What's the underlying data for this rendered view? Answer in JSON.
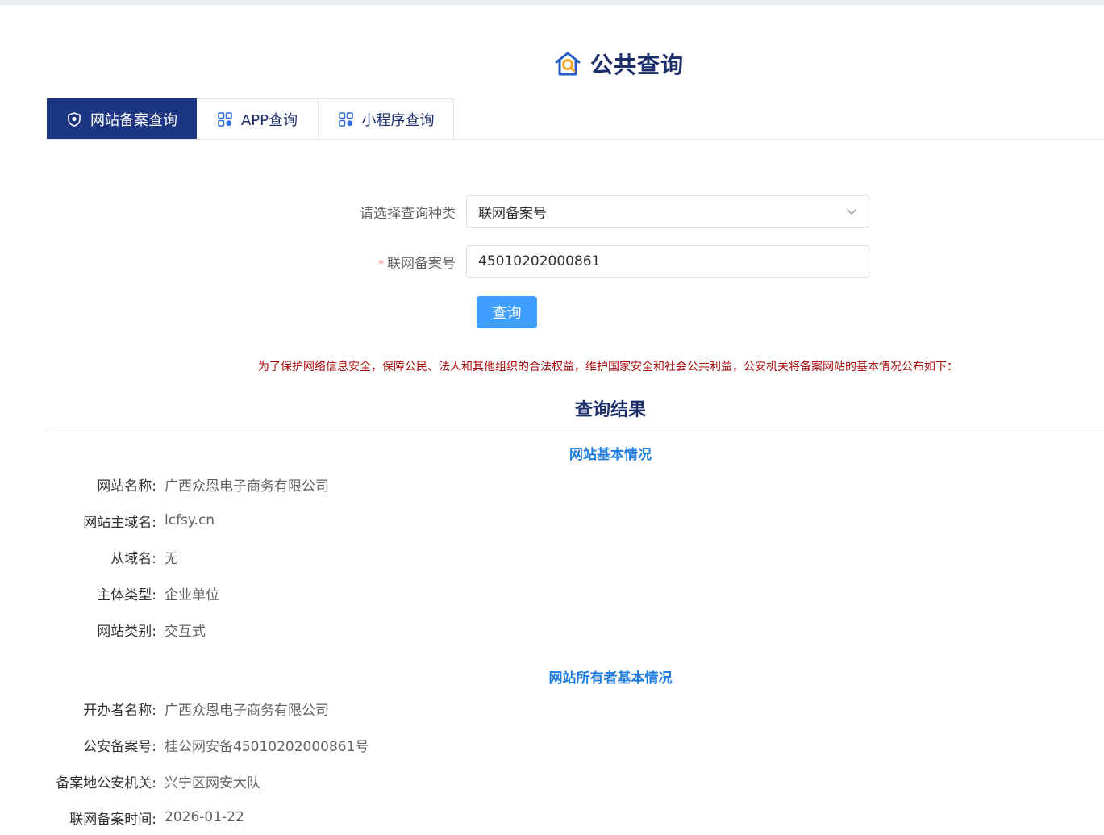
{
  "header": {
    "title": "公共查询"
  },
  "tabs": [
    {
      "label": "网站备案查询",
      "active": true,
      "icon": "shield-icon"
    },
    {
      "label": "APP查询",
      "active": false,
      "icon": "grid-icon"
    },
    {
      "label": "小程序查询",
      "active": false,
      "icon": "grid-icon"
    }
  ],
  "form": {
    "query_type_label": "请选择查询种类",
    "query_type_value": "联网备案号",
    "record_label": "联网备案号",
    "required_mark": "*",
    "record_value": "45010202000861",
    "submit_label": "查询"
  },
  "notice": "为了保护网络信息安全，保障公民、法人和其他组织的合法权益，维护国家安全和社会公共利益，公安机关将备案网站的基本情况公布如下：",
  "results": {
    "title": "查询结果",
    "site_section": {
      "title": "网站基本情况",
      "rows": [
        {
          "label": "网站名称:",
          "value": "广西众恩电子商务有限公司"
        },
        {
          "label": "网站主域名:",
          "value": "lcfsy.cn"
        },
        {
          "label": "从域名:",
          "value": "无"
        },
        {
          "label": "主体类型:",
          "value": "企业单位"
        },
        {
          "label": "网站类别:",
          "value": "交互式"
        }
      ]
    },
    "owner_section": {
      "title": "网站所有者基本情况",
      "rows": [
        {
          "label": "开办者名称:",
          "value": "广西众恩电子商务有限公司"
        },
        {
          "label": "公安备案号:",
          "value": "桂公网安备45010202000861号"
        },
        {
          "label": "备案地公安机关:",
          "value": "兴宁区网安大队"
        },
        {
          "label": "联网备案时间:",
          "value": "2026-01-22"
        }
      ]
    }
  },
  "colors": {
    "brand_navy": "#1d3682",
    "primary_blue": "#409eff",
    "section_blue": "#1e7be0",
    "notice_red": "#a50a0a"
  }
}
